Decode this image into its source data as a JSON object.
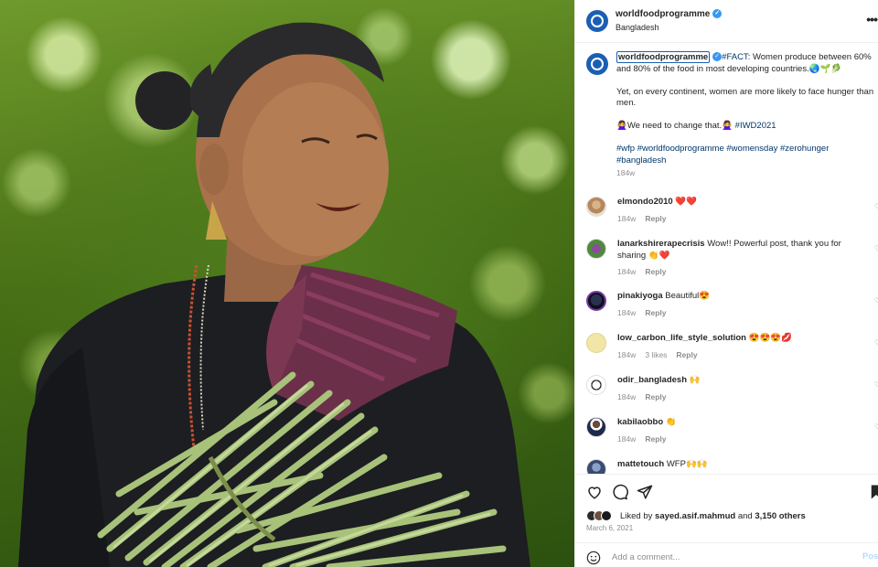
{
  "post": {
    "username": "worldfoodprogramme",
    "location": "Bangladesh",
    "verified_icon": "verified-badge-icon"
  },
  "caption": {
    "username": "worldfoodprogramme",
    "hashtag_fact": "#FACT",
    "line1": ": Women produce between 60% and 80% of the food in most developing countries.🌏🌱🥬",
    "line2": "Yet, on every continent, women are more likely to face hunger than men.",
    "line3_text": "🙅‍♀️We need to change that.🙅‍♀️",
    "line3_tag": "#IWD2021",
    "hashtags": "#wfp #worldfoodprogramme #womensday #zerohunger #bangladesh",
    "time": "184w"
  },
  "comments": [
    {
      "user": "elmondo2010",
      "text": "❤️❤️",
      "time": "184w",
      "likes": "",
      "reply": "Reply"
    },
    {
      "user": "lanarkshirerapecrisis",
      "text": "Wow!! Powerful post, thank you for sharing 👏❤️",
      "time": "184w",
      "likes": "",
      "reply": "Reply"
    },
    {
      "user": "pinakiyoga",
      "text": "Beautiful😍",
      "time": "184w",
      "likes": "",
      "reply": "Reply"
    },
    {
      "user": "low_carbon_life_style_solution",
      "text": "😍😍😍💋",
      "time": "184w",
      "likes": "3 likes",
      "reply": "Reply"
    },
    {
      "user": "odir_bangladesh",
      "text": "🙌",
      "time": "184w",
      "likes": "",
      "reply": "Reply"
    },
    {
      "user": "kabilaobbo",
      "text": "👏",
      "time": "184w",
      "likes": "",
      "reply": "Reply"
    },
    {
      "user": "mattetouch",
      "text": "WFP🙌🙌",
      "time": "",
      "likes": "",
      "reply": ""
    }
  ],
  "likes": {
    "prefix": "Liked by ",
    "user": "sayed.asif.mahmud",
    "middle": " and ",
    "count": "3,150 others"
  },
  "date": "March 6, 2021",
  "add_comment": {
    "placeholder": "Add a comment...",
    "post_label": "Post"
  },
  "colors": {
    "brand_blue": "#1a5fb4",
    "link": "#00376b",
    "muted": "#8e8e8e"
  }
}
